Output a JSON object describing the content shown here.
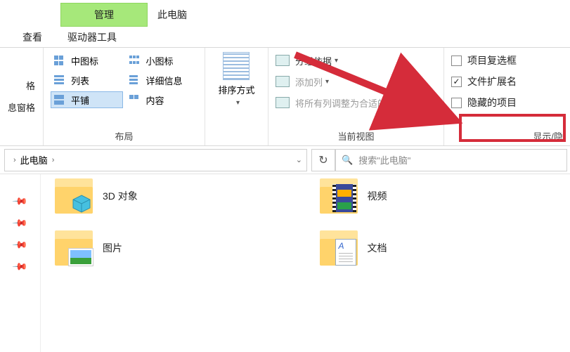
{
  "tabs": {
    "manage": "管理",
    "pc": "此电脑",
    "view": "查看",
    "drive_tools": "驱动器工具"
  },
  "pane": {
    "item1": "格",
    "item2": "息窗格"
  },
  "layout": {
    "medium": "中图标",
    "small": "小图标",
    "list": "列表",
    "details": "详细信息",
    "tile": "平铺",
    "content": "内容",
    "group_label": "布局"
  },
  "sort": {
    "label": "排序方式"
  },
  "view": {
    "group_by": "分组依据",
    "add_col": "添加列",
    "fit_cols": "将所有列调整为合适的大小",
    "group_label": "当前视图"
  },
  "show": {
    "item_checkboxes": "项目复选框",
    "file_ext": "文件扩展名",
    "hidden": "隐藏的项目",
    "group_label": "显示/隐"
  },
  "nav": {
    "crumb": "此电脑",
    "search_placeholder": "搜索\"此电脑\""
  },
  "items": {
    "header_cut": "",
    "obj3d": "3D 对象",
    "video": "视频",
    "pictures": "图片",
    "docs": "文档"
  }
}
